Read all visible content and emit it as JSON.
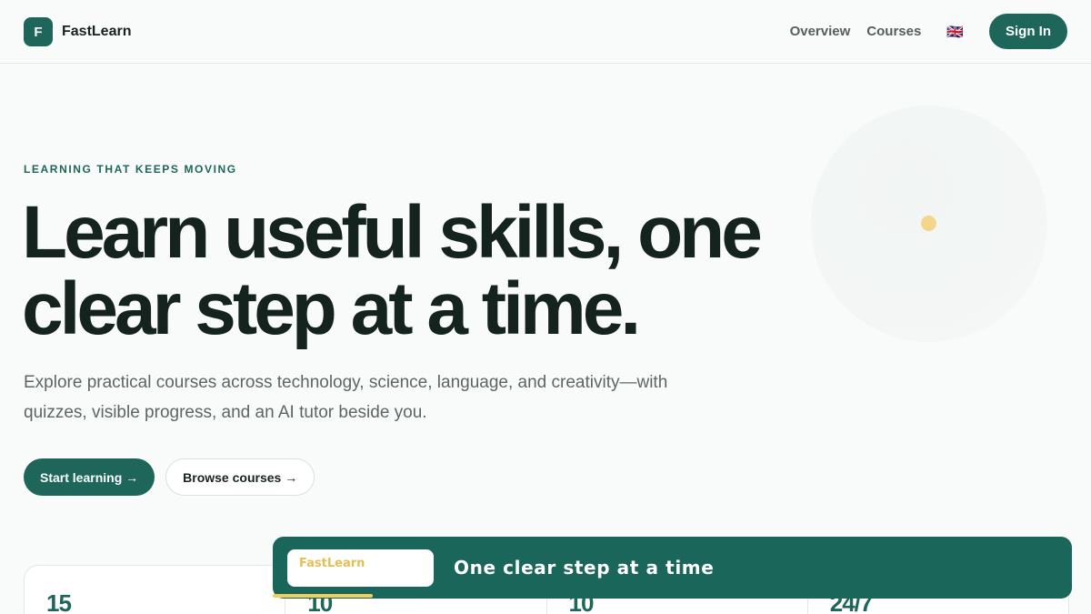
{
  "header": {
    "brand_mark": "F",
    "brand_name": "FastLearn",
    "nav": [
      {
        "label": "Overview"
      },
      {
        "label": "Courses"
      }
    ],
    "language_flag": "🇬🇧",
    "sign_in_label": "Sign In"
  },
  "hero": {
    "kicker": "LEARNING THAT KEEPS MOVING",
    "headline": "Learn useful skills, one clear step at a time.",
    "subtext": "Explore practical courses across technology, science, language, and creativity—with quizzes, visible progress, and an AI tutor beside you.",
    "primary_cta": "Start learning →",
    "secondary_cta": "Browse courses →"
  },
  "stats": [
    {
      "value": "15"
    },
    {
      "value": "10"
    },
    {
      "value": "10"
    },
    {
      "value": "24/7"
    }
  ],
  "banner": {
    "logo_text": "FastLearn",
    "tagline": "One clear step at a time"
  },
  "colors": {
    "brand": "#1d6659",
    "accent": "#f4d58a",
    "background": "#f8fbfa"
  },
  "icons": {
    "language": "uk-flag-icon",
    "arrow": "arrow-right-icon"
  }
}
